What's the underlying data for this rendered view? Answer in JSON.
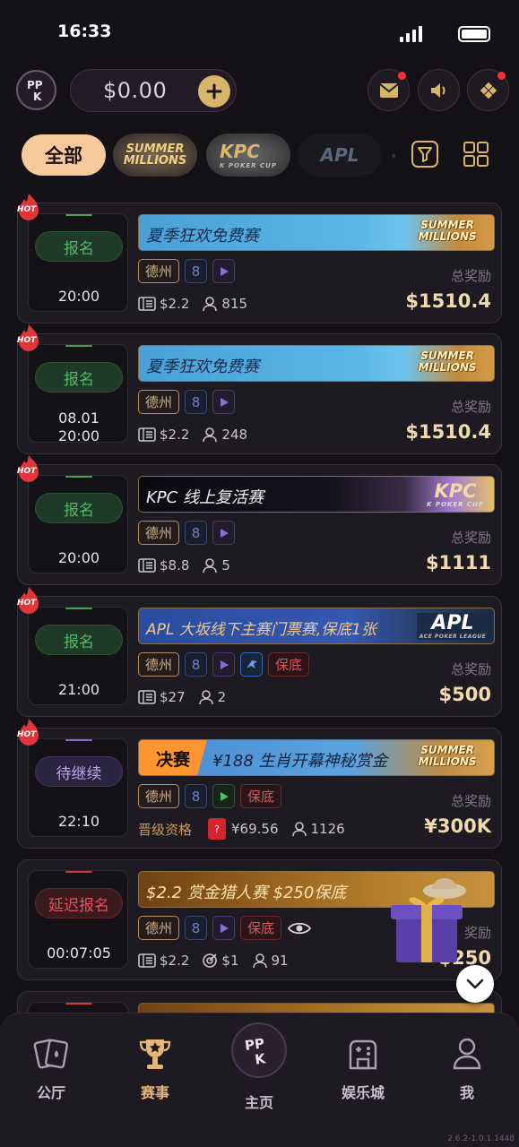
{
  "status_bar": {
    "time": "16:33"
  },
  "header": {
    "balance": "$0.00",
    "icons": [
      "mail-icon",
      "speaker-icon",
      "game-icon"
    ]
  },
  "filters": {
    "all_label": "全部",
    "chips": [
      {
        "name": "summer-millions",
        "text": "SUMMER MILLIONS"
      },
      {
        "name": "kpc",
        "text": "KPC",
        "sub": "K POKER CUP"
      },
      {
        "name": "apl",
        "text": "APL"
      }
    ]
  },
  "cards": [
    {
      "hot": "HOT",
      "status": "报名",
      "time1": "",
      "time2": "20:00",
      "title": "夏季狂欢免费赛",
      "logo": "SUMMER MILLIONS",
      "tags": [
        "德州",
        "8"
      ],
      "buyin": "$2.2",
      "players": "815",
      "total_label": "总奖励",
      "prize": "$1510.4"
    },
    {
      "hot": "HOT",
      "status": "报名",
      "time1": "08.01",
      "time2": "20:00",
      "title": "夏季狂欢免费赛",
      "logo": "SUMMER MILLIONS",
      "tags": [
        "德州",
        "8"
      ],
      "buyin": "$2.2",
      "players": "248",
      "total_label": "总奖励",
      "prize": "$1510.4"
    },
    {
      "hot": "HOT",
      "status": "报名",
      "time1": "",
      "time2": "20:00",
      "title": "KPC 线上复活赛",
      "logo": "KPC",
      "logo_sub": "K POKER CUP",
      "tags": [
        "德州",
        "8"
      ],
      "buyin": "$8.8",
      "players": "5",
      "total_label": "总奖励",
      "prize": "$1111"
    },
    {
      "hot": "HOT",
      "status": "报名",
      "time1": "",
      "time2": "21:00",
      "title": "APL 大坂线下主赛门票赛,保底1张",
      "logo": "APL",
      "logo_sub": "ACE POKER LEAGUE",
      "tags": [
        "德州",
        "8",
        "保底"
      ],
      "buyin": "$27",
      "players": "2",
      "total_label": "总奖励",
      "prize": "$500"
    },
    {
      "hot": "HOT",
      "status": "待继续",
      "time1": "",
      "time2": "22:10",
      "final_tag": "决赛",
      "title": "¥188 生肖开幕神秘赏金",
      "logo": "SUMMER MILLIONS",
      "tags": [
        "德州",
        "8",
        "保底"
      ],
      "qual": "晋级资格",
      "ticket": "¥69.56",
      "players": "1126",
      "total_label": "总奖励",
      "prize": "¥300K"
    },
    {
      "hot": "",
      "status": "延迟报名",
      "time1": "",
      "time2": "00:07:05",
      "title": "$2.2 赏金猎人赛 $250保底",
      "tags": [
        "德州",
        "8",
        "保底"
      ],
      "buyin": "$2.2",
      "bounty": "$1",
      "players": "91",
      "total_label": "奖励",
      "prize": "$250"
    }
  ],
  "nav": [
    {
      "label": "公厅",
      "icon": "cards-icon"
    },
    {
      "label": "赛事",
      "icon": "trophy-icon"
    },
    {
      "label": "主页",
      "icon": "home-logo-icon"
    },
    {
      "label": "娱乐城",
      "icon": "arcade-icon"
    },
    {
      "label": "我",
      "icon": "user-icon"
    }
  ],
  "version": "2.6.2-1.0.1.1448",
  "colors": {
    "accent": "#f5c99a",
    "prize": "#f1d9b0",
    "green": "#54b96a",
    "red": "#e5535c"
  }
}
